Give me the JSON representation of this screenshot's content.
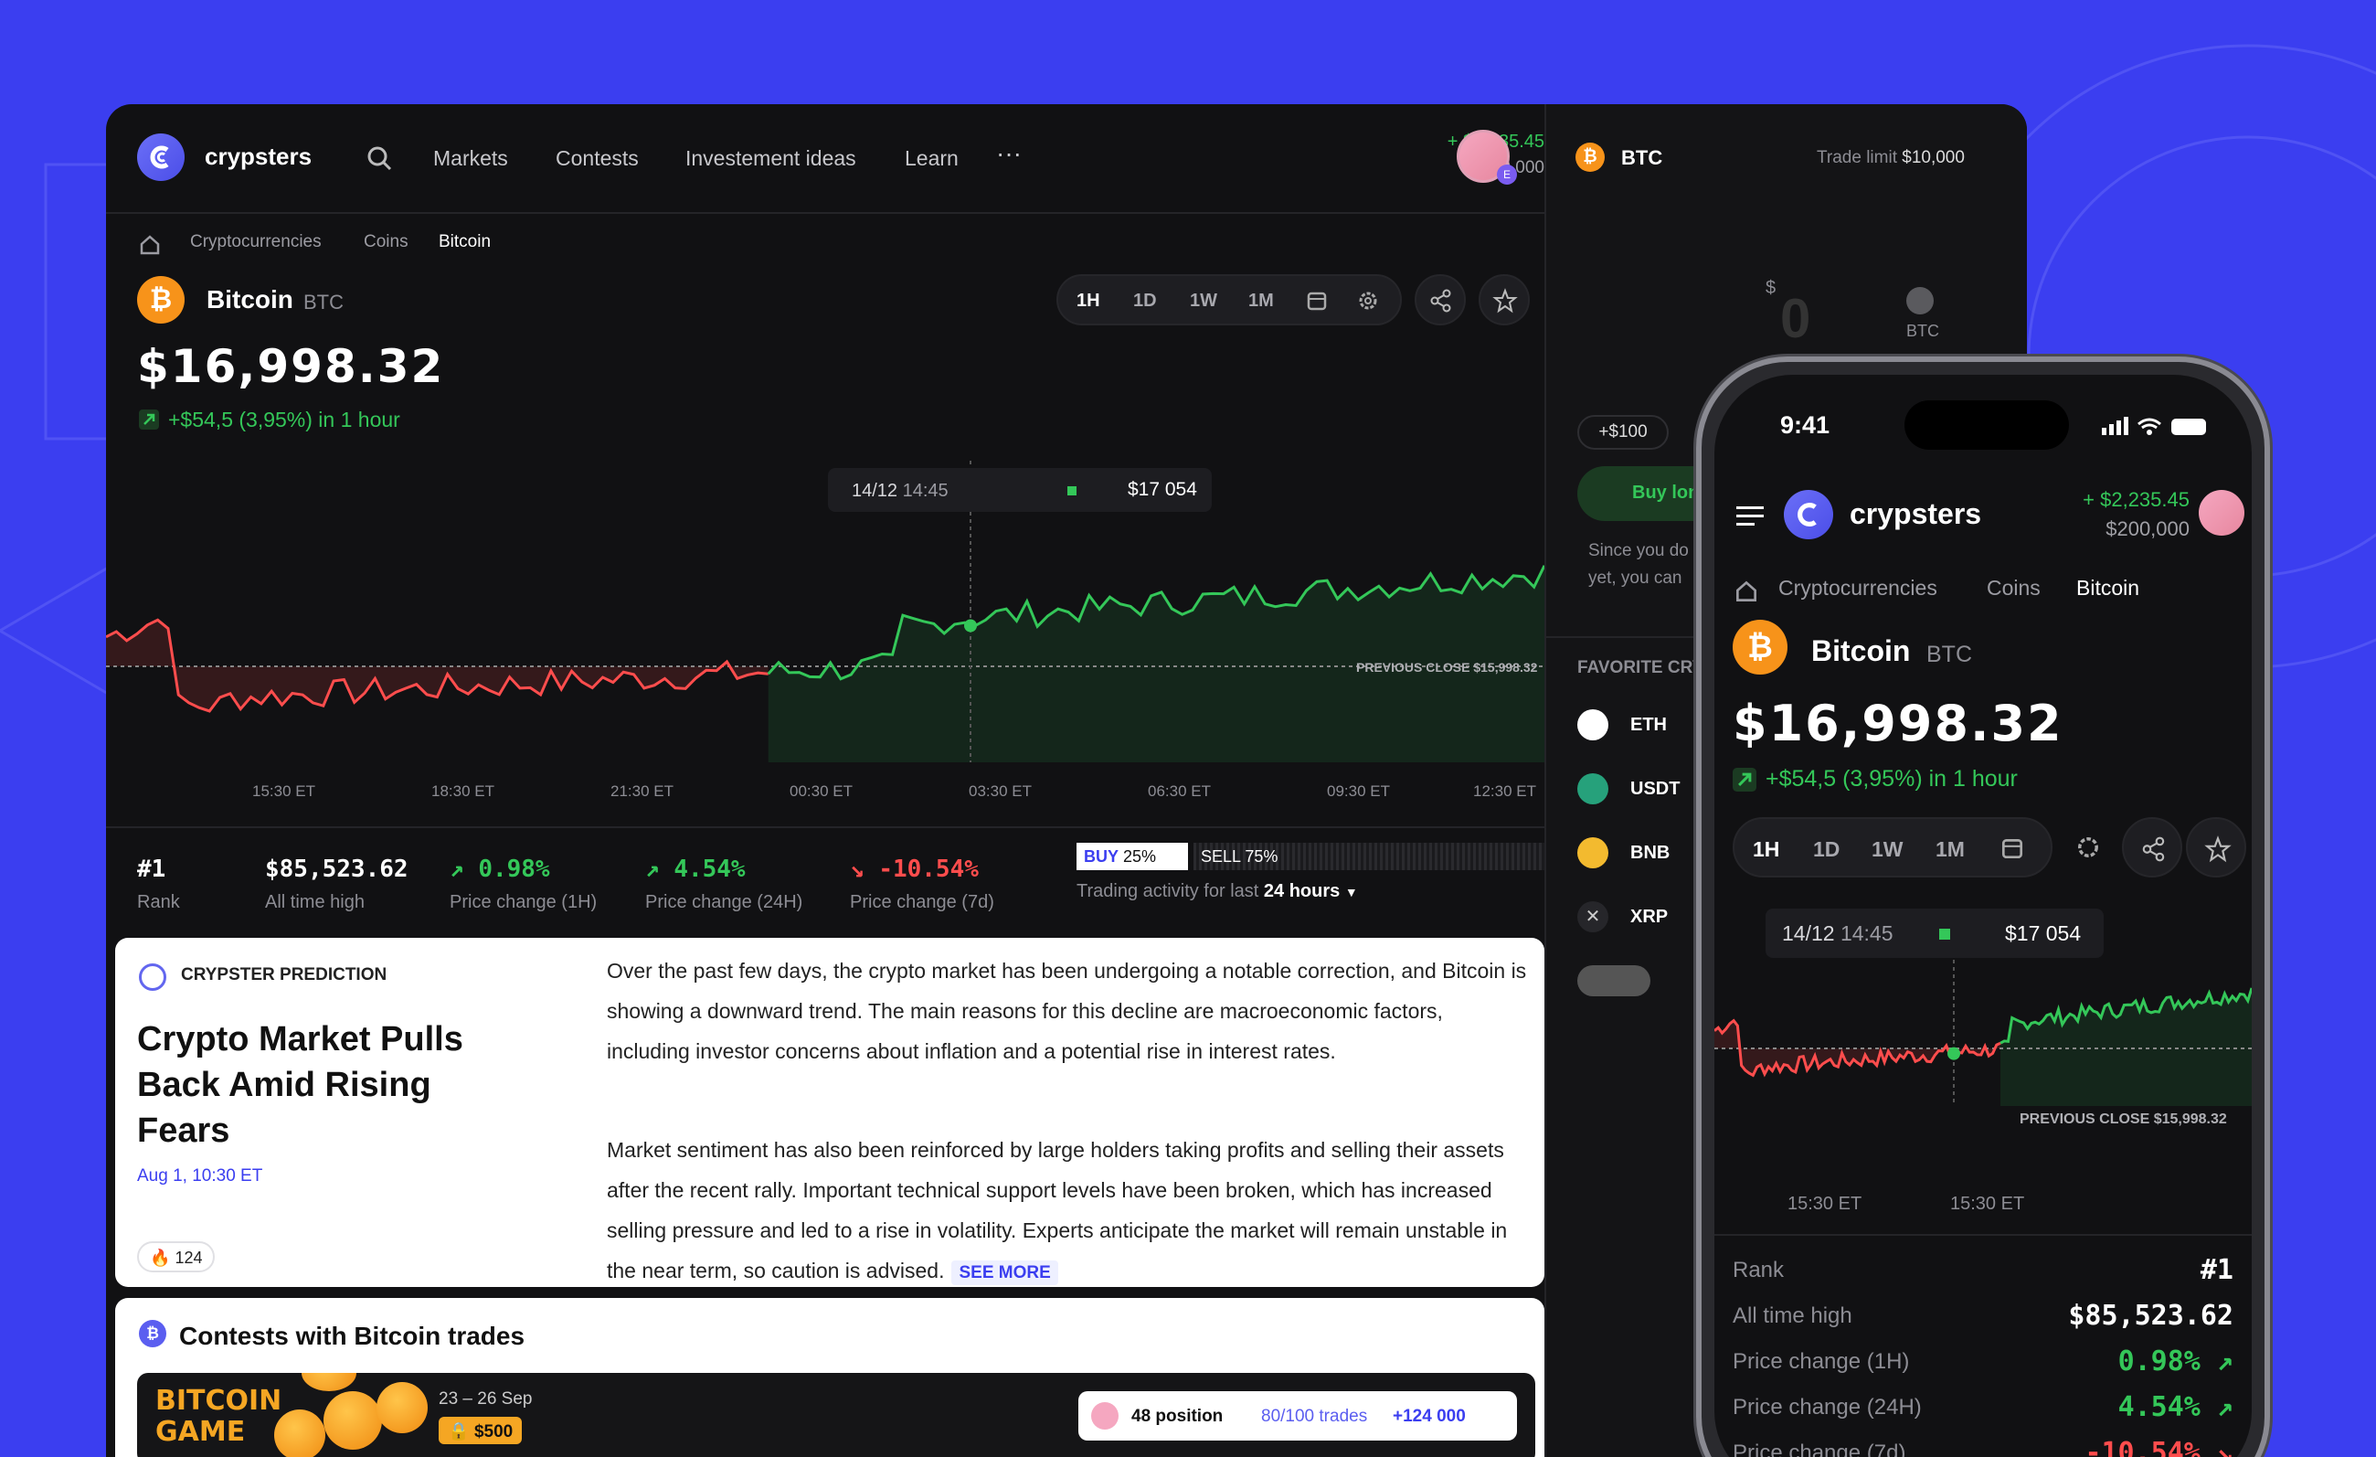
{
  "app": {
    "brand": "crypsters"
  },
  "nav": {
    "items": [
      "Markets",
      "Contests",
      "Investement ideas",
      "Learn"
    ],
    "more": "···"
  },
  "balance": {
    "gain": "+ $2,235.45",
    "wallet": "$200,000"
  },
  "breadcrumb": [
    "Cryptocurrencies",
    "Coins",
    "Bitcoin"
  ],
  "coin": {
    "name": "Bitcoin",
    "symbol": "BTC",
    "price": "$16,998.32",
    "change": "+$54,5 (3,95%) in 1 hour"
  },
  "timeframes": [
    "1H",
    "1D",
    "1W",
    "1M"
  ],
  "tooltip": {
    "date": "14/12",
    "time": "14:45",
    "value": "$17 054"
  },
  "previous_close": "PREVIOUS CLOSE $15,998.32",
  "x_ticks": [
    "15:30 ET",
    "18:30 ET",
    "21:30 ET",
    "00:30 ET",
    "03:30 ET",
    "06:30 ET",
    "09:30 ET",
    "12:30 ET"
  ],
  "stats": {
    "rank": {
      "value": "#1",
      "label": "Rank"
    },
    "ath": {
      "value": "$85,523.62",
      "label": "All time high"
    },
    "ch1h": {
      "value": "0.98%",
      "label": "Price change (1H)"
    },
    "ch24h": {
      "value": "4.54%",
      "label": "Price change (24H)"
    },
    "ch7d": {
      "value": "-10.54%",
      "label": "Price change (7d)"
    }
  },
  "trading": {
    "buy_label": "BUY",
    "buy_pct": "25%",
    "sell_label": "SELL",
    "sell_pct": "75%",
    "text": "Trading activity for last",
    "period": "24 hours"
  },
  "prediction": {
    "tag": "CRYPSTER PREDICTION",
    "title": "Crypto Market Pulls Back Amid Rising Fears",
    "date": "Aug 1, 10:30 ET",
    "likes": "124",
    "para1": "Over the past few days, the crypto market has been undergoing a notable correction, and Bitcoin is showing a downward trend. The main reasons for this decline are macroeconomic factors, including investor concerns about inflation and a potential rise in interest rates.",
    "para2": "Market sentiment has also been reinforced by large holders taking profits and selling their assets after the recent rally. Important technical support levels have been broken, which has increased selling pressure and led to a rise in volatility. Experts anticipate the market will remain unstable in the near term, so caution is advised.",
    "see_more": "SEE MORE"
  },
  "contests": {
    "title": "Contests with Bitcoin trades",
    "game": "BITCOIN GAME",
    "dates": "23 – 26 Sep",
    "prize": "$500",
    "position": "48 position",
    "trades": "80/100 trades",
    "reward": "+124 000"
  },
  "right_panel": {
    "symbol": "BTC",
    "trade_limit_label": "Trade limit",
    "trade_limit": "$10,000",
    "currency": "$",
    "amount": "0",
    "unit": "BTC",
    "chip": "+$100",
    "buy": "Buy lon",
    "since": "Since you do",
    "since2": "yet, you can",
    "favorites": "FAVORITE CRY",
    "coins": [
      "ETH",
      "USDT",
      "BNB",
      "XRP"
    ]
  },
  "phone": {
    "time": "9:41",
    "x_ticks": [
      "15:30 ET",
      "15:30 ET"
    ],
    "rows": [
      {
        "label": "Rank",
        "value": "#1"
      },
      {
        "label": "All time high",
        "value": "$85,523.62"
      },
      {
        "label": "Price change (1H)",
        "value": "0.98%"
      },
      {
        "label": "Price change (24H)",
        "value": "4.54%"
      },
      {
        "label": "Price change (7d)",
        "value": "-10.54%"
      }
    ]
  },
  "colors": {
    "accent": "#3b3ef0",
    "up": "#34c759",
    "down": "#ff4d4d",
    "btc": "#f7931a"
  }
}
